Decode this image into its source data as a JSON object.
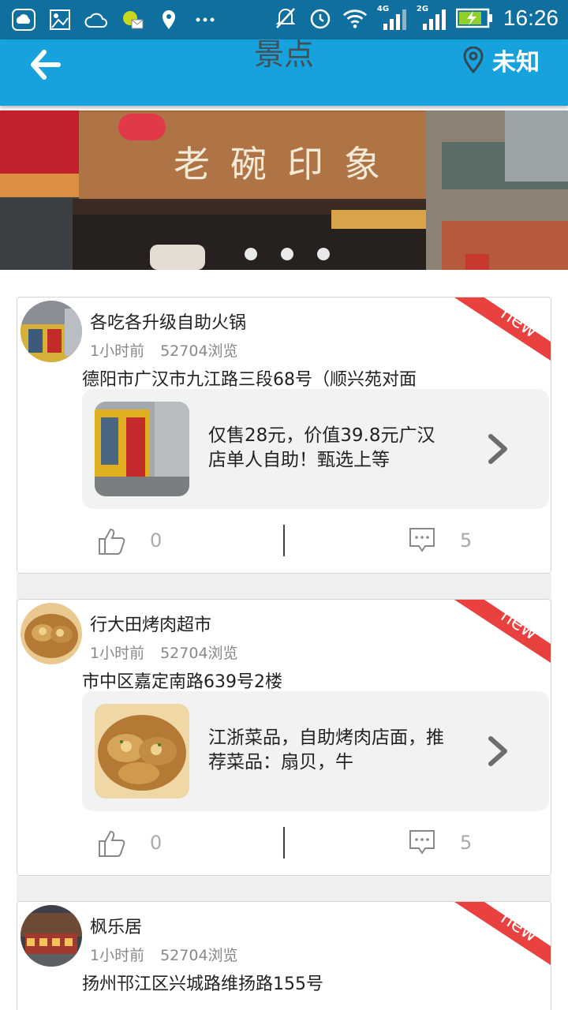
{
  "status_bar": {
    "time": "16:26",
    "network_labels": [
      "4G",
      "2G"
    ],
    "icons": [
      "cloud-icon",
      "image-icon",
      "weather-cloud-icon",
      "chat-icon",
      "location-pin-icon",
      "more-dots-icon",
      "mute-icon",
      "alarm-icon",
      "wifi-icon",
      "signal-4g-icon",
      "signal-2g-icon",
      "battery-charging-icon"
    ]
  },
  "header": {
    "title": "景点",
    "location": "未知",
    "back_icon": "arrow-left-icon",
    "location_icon": "location-pin-icon",
    "color": "#16a2dc"
  },
  "banner": {
    "slide_count": 3,
    "sign_text": "老碗印象"
  },
  "posts": [
    {
      "name": "各吃各升级自助火锅",
      "time": "1小时前",
      "views": "52704浏览",
      "address": "德阳市广汉市九江路三段68号（顺兴苑对面",
      "badge": "new",
      "description": "仅售28元，价值39.8元广汉店单人自助！甄选上等",
      "likes": "0",
      "comments": "5"
    },
    {
      "name": "行大田烤肉超市",
      "time": "1小时前",
      "views": "52704浏览",
      "address": "市中区嘉定南路639号2楼",
      "badge": "new",
      "description": "江浙菜品，自助烤肉店面，推荐菜品：扇贝，牛",
      "likes": "0",
      "comments": "5"
    },
    {
      "name": "枫乐居",
      "time": "1小时前",
      "views": "52704浏览",
      "address": "扬州邗江区兴城路维扬路155号",
      "badge": "new"
    }
  ],
  "colors": {
    "badge_red": "#e8413f",
    "status_bar": "#0f6f9e"
  }
}
